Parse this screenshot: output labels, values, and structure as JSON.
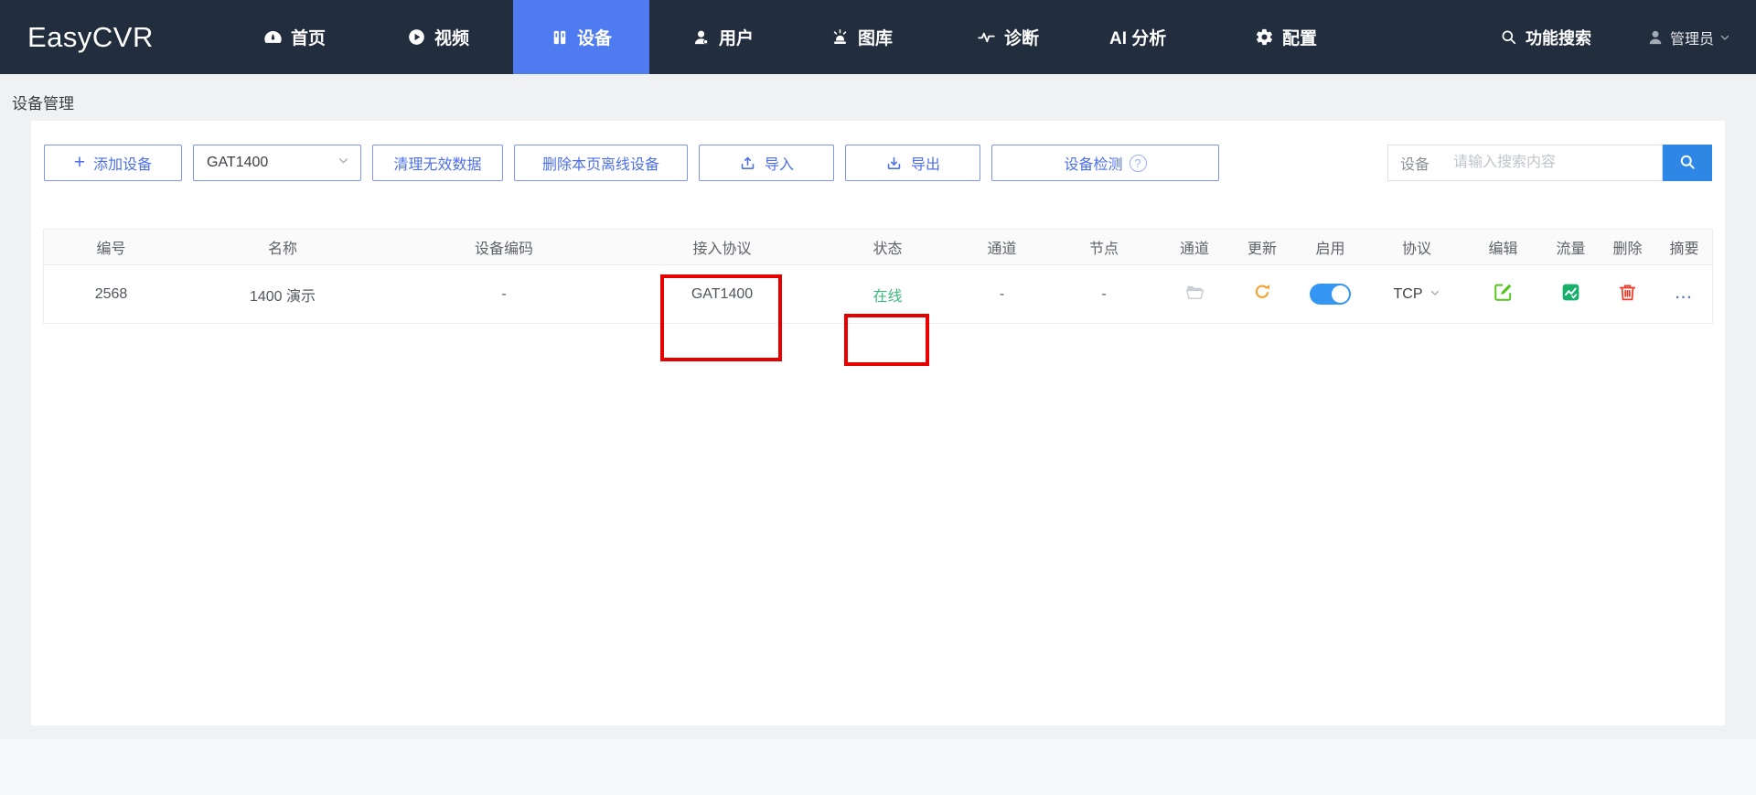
{
  "brand": "EasyCVR",
  "nav": {
    "items": [
      {
        "label": "首页",
        "icon": "dashboard-icon"
      },
      {
        "label": "视频",
        "icon": "play-circle-icon"
      },
      {
        "label": "设备",
        "icon": "device-rack-icon",
        "active": true
      },
      {
        "label": "用户",
        "icon": "user-icon"
      },
      {
        "label": "图库",
        "icon": "alarm-beacon-icon"
      },
      {
        "label": "诊断",
        "icon": "pulse-icon"
      },
      {
        "label": "AI 分析",
        "icon": "none"
      },
      {
        "label": "配置",
        "icon": "gear-icon"
      }
    ],
    "function_search": "功能搜索",
    "admin": "管理员"
  },
  "breadcrumb": "设备管理",
  "toolbar": {
    "add_device": "添加设备",
    "protocol_filter": "GAT1400",
    "clean_invalid": "清理无效数据",
    "delete_offline_page": "删除本页离线设备",
    "import_label": "导入",
    "export_label": "导出",
    "device_check": "设备检测",
    "search_scope": "设备",
    "search_placeholder": "请输入搜索内容"
  },
  "icons": {
    "plus": "+",
    "help": "?"
  },
  "table": {
    "headers": [
      "编号",
      "名称",
      "设备编码",
      "接入协议",
      "状态",
      "通道",
      "节点",
      "通道",
      "更新",
      "启用",
      "协议",
      "编辑",
      "流量",
      "删除",
      "摘要"
    ],
    "row": {
      "id": "2568",
      "name": "1400 演示",
      "device_code": "-",
      "access_protocol": "GAT1400",
      "status": "在线",
      "channels": "-",
      "node": "-",
      "stream_protocol": "TCP",
      "enabled": true,
      "summary": "..."
    }
  },
  "colors": {
    "nav_bg": "#222d3d",
    "active_tab": "#4e7bef",
    "button_blue": "#4d6fe8",
    "search_button_blue": "#2e87e4",
    "online_green": "#3eb97c",
    "toggle_on_blue": "#3595f2",
    "refresh_orange": "#f7a12f",
    "edit_green": "#52c41a",
    "traffic_green": "#17b06b",
    "delete_red": "#ee3b28",
    "annotation_red": "#e60000"
  }
}
